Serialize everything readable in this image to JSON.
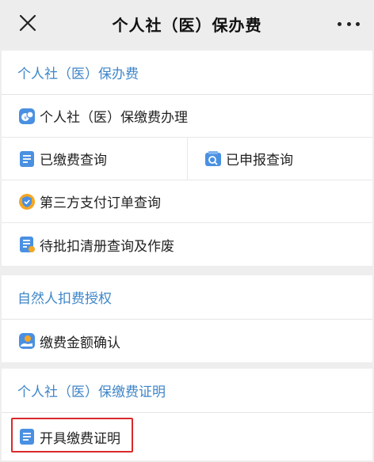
{
  "header": {
    "title": "个人社（医）保办费",
    "close_icon": "close-icon",
    "more_icon": "more-icon"
  },
  "sections": [
    {
      "title": "个人社（医）保办费",
      "items": [
        {
          "label": "个人社（医）保缴费办理",
          "icon": "coin-icon"
        },
        {
          "label": "已缴费查询",
          "icon": "document-icon"
        },
        {
          "label": "已申报查询",
          "icon": "report-search-icon"
        },
        {
          "label": "第三方支付订单查询",
          "icon": "shield-icon"
        },
        {
          "label": "待批扣清册查询及作废",
          "icon": "list-icon"
        }
      ]
    },
    {
      "title": "自然人扣费授权",
      "items": [
        {
          "label": "缴费金额确认",
          "icon": "hand-coin-icon"
        }
      ]
    },
    {
      "title": "个人社（医）保缴费证明",
      "items": [
        {
          "label": "开具缴费证明",
          "icon": "certificate-icon"
        }
      ]
    }
  ],
  "colors": {
    "accent": "#3f86c8",
    "highlight": "#d92a2a",
    "background": "#eeeeee"
  }
}
